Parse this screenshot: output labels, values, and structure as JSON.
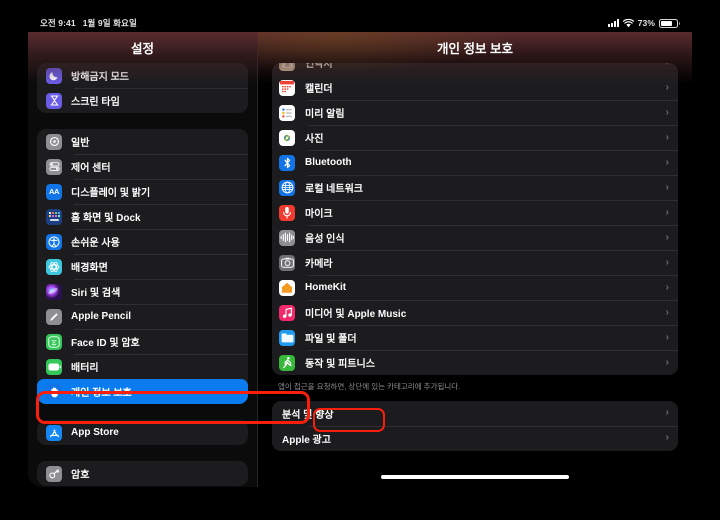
{
  "statusbar": {
    "time": "오전 9:41",
    "date": "1월 9일 화요일",
    "battery_percent": "73%",
    "signal_icon": "cellular-signal-icon",
    "wifi_icon": "wifi-icon",
    "battery_icon": "battery-icon"
  },
  "sidebar": {
    "title": "설정",
    "groups": [
      {
        "items": [
          {
            "label": "방해금지 모드",
            "icon": "moon-icon",
            "color": "#6b5ce7"
          },
          {
            "label": "스크린 타임",
            "icon": "hourglass-icon",
            "color": "#6b5ce7"
          }
        ]
      },
      {
        "items": [
          {
            "label": "일반",
            "icon": "gear-icon",
            "color": "#8e8e93"
          },
          {
            "label": "제어 센터",
            "icon": "sliders-icon",
            "color": "#8e8e93"
          },
          {
            "label": "디스플레이 및 밝기",
            "icon": "text-size-icon",
            "color": "#1175e8"
          },
          {
            "label": "홈 화면 및 Dock",
            "icon": "app-grid-icon",
            "color": "#1b3f80"
          },
          {
            "label": "손쉬운 사용",
            "icon": "accessibility-icon",
            "color": "#1175e8"
          },
          {
            "label": "배경화면",
            "icon": "wallpaper-icon",
            "color": "#3ec7dd"
          },
          {
            "label": "Siri 및 검색",
            "icon": "siri-icon",
            "color": "#6a2fd4"
          },
          {
            "label": "Apple Pencil",
            "icon": "pencil-icon",
            "color": "#8e8e93"
          },
          {
            "label": "Face ID 및 암호",
            "icon": "face-id-icon",
            "color": "#34c759"
          },
          {
            "label": "배터리",
            "icon": "battery-icon",
            "color": "#34c759"
          },
          {
            "label": "개인 정보 보호",
            "icon": "hand-raised-icon",
            "color": "#1175e8",
            "selected": true
          }
        ]
      },
      {
        "items": [
          {
            "label": "App Store",
            "icon": "app-store-icon",
            "color": "#1487f5"
          }
        ]
      },
      {
        "items": [
          {
            "label": "암호",
            "icon": "key-icon",
            "color": "#8e8e93"
          }
        ]
      }
    ]
  },
  "content": {
    "title": "개인 정보 보호",
    "clipped_item": {
      "label": "연락처",
      "icon": "contacts-icon",
      "color": "#c8b79a",
      "chevron": "›"
    },
    "permission_items": [
      {
        "label": "캘린더",
        "icon": "calendar-icon",
        "color": "#ffffff",
        "chevron": "›"
      },
      {
        "label": "미리 알림",
        "icon": "reminders-icon",
        "color": "#ffffff",
        "chevron": "›"
      },
      {
        "label": "사진",
        "icon": "photos-icon",
        "color": "#ffffff",
        "chevron": "›"
      },
      {
        "label": "Bluetooth",
        "icon": "bluetooth-icon",
        "color": "#1175e8",
        "chevron": "›"
      },
      {
        "label": "로컬 네트워크",
        "icon": "globe-icon",
        "color": "#1175e8",
        "chevron": "›"
      },
      {
        "label": "마이크",
        "icon": "microphone-icon",
        "color": "#f23b30",
        "chevron": "›"
      },
      {
        "label": "음성 인식",
        "icon": "waveform-icon",
        "color": "#8e8e93",
        "chevron": "›"
      },
      {
        "label": "카메라",
        "icon": "camera-icon",
        "color": "#6e6e73",
        "chevron": "›"
      },
      {
        "label": "HomeKit",
        "icon": "homekit-icon",
        "color": "#ffffff",
        "chevron": "›"
      },
      {
        "label": "미디어 및 Apple Music",
        "icon": "music-icon",
        "color": "#f4296b",
        "chevron": "›"
      },
      {
        "label": "파일 및 폴더",
        "icon": "folder-icon",
        "color": "#1f9cf0",
        "chevron": "›"
      },
      {
        "label": "동작 및 피트니스",
        "icon": "fitness-icon",
        "color": "#36b93a",
        "chevron": "›"
      }
    ],
    "footnote": "앱이 접근을 요청하면, 상단에 있는 카테고리에 추가됩니다.",
    "bottom_items": [
      {
        "label": "분석 및 향상",
        "chevron": "›",
        "annotated": true
      },
      {
        "label": "Apple 광고",
        "chevron": "›"
      }
    ]
  },
  "annotations": {
    "color": "#f81f0d",
    "targets": [
      "개인 정보 보호",
      "분석 및 향상"
    ]
  }
}
